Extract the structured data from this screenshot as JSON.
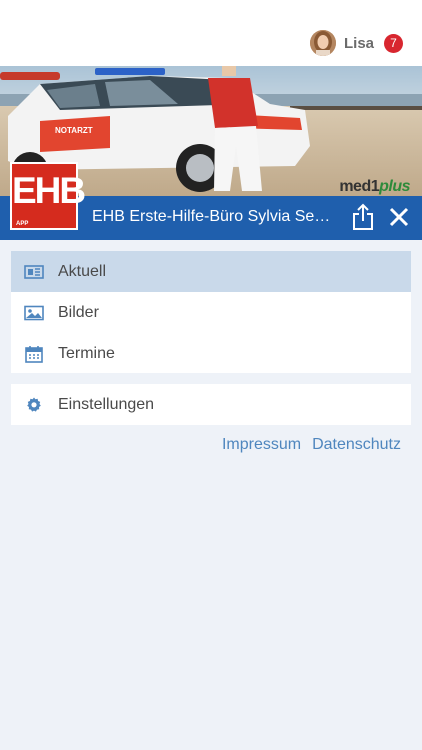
{
  "user": {
    "name": "Lisa",
    "notification_count": "7"
  },
  "banner": {
    "logo_text": "EHB",
    "logo_subtext": "APP",
    "partner_logo_prefix": "med1",
    "partner_logo_suffix": "plus",
    "vehicle_label": "NOTARZT"
  },
  "header": {
    "title": "EHB Erste-Hilfe-Büro  Sylvia Sebastian",
    "share_icon": "share-icon",
    "close_icon": "close-icon"
  },
  "menu": {
    "items": [
      {
        "label": "Aktuell",
        "icon": "newspaper-icon",
        "active": true
      },
      {
        "label": "Bilder",
        "icon": "image-icon",
        "active": false
      },
      {
        "label": "Termine",
        "icon": "calendar-icon",
        "active": false
      }
    ],
    "settings": {
      "label": "Einstellungen",
      "icon": "gear-icon"
    }
  },
  "footer_links": {
    "impressum": "Impressum",
    "datenschutz": "Datenschutz"
  },
  "colors": {
    "header_blue": "#1f5fad",
    "active_item": "#c9d9ea",
    "link_blue": "#4f86be",
    "badge_red": "#d8262f",
    "background": "#eef2f8"
  }
}
